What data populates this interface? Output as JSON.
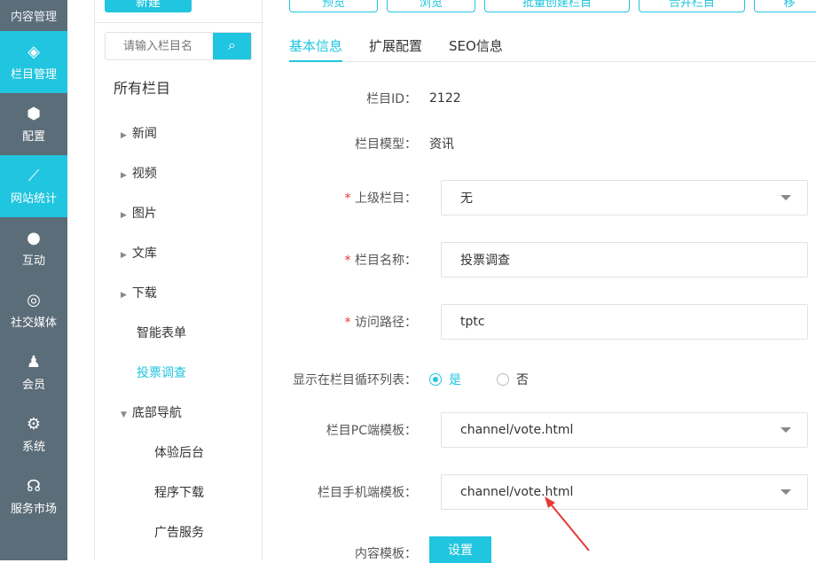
{
  "nav": [
    {
      "label": "内容管理",
      "icon": "document-icon"
    },
    {
      "label": "栏目管理",
      "icon": "layers-icon",
      "active": true
    },
    {
      "label": "配置",
      "icon": "cube-icon"
    },
    {
      "label": "网站统计",
      "icon": "chart-icon",
      "active": true
    },
    {
      "label": "互动",
      "icon": "chat-icon"
    },
    {
      "label": "社交媒体",
      "icon": "social-icon"
    },
    {
      "label": "会员",
      "icon": "user-icon"
    },
    {
      "label": "系统",
      "icon": "gear-icon"
    },
    {
      "label": "服务市场",
      "icon": "headset-icon"
    }
  ],
  "tree": {
    "new_label": "新建",
    "search_placeholder": "请输入栏目名",
    "all_label": "所有栏目",
    "items": [
      {
        "label": "新闻"
      },
      {
        "label": "视频"
      },
      {
        "label": "图片"
      },
      {
        "label": "文库"
      },
      {
        "label": "下载"
      },
      {
        "label": "智能表单"
      },
      {
        "label": "投票调查"
      },
      {
        "label": "底部导航"
      },
      {
        "label": "体验后台"
      },
      {
        "label": "程序下载"
      },
      {
        "label": "广告服务"
      }
    ]
  },
  "toolbar": [
    "预览",
    "浏览",
    "批量创建栏目",
    "合并栏目",
    "移"
  ],
  "tabs": [
    "基本信息",
    "扩展配置",
    "SEO信息"
  ],
  "form": {
    "id_label": "栏目ID：",
    "id_value": "2122",
    "model_label": "栏目模型：",
    "model_value": "资讯",
    "parent_label": "上级栏目：",
    "parent_value": "无",
    "name_label": "栏目名称：",
    "name_value": "投票调查",
    "path_label": "访问路径：",
    "path_value": "tptc",
    "show_label": "显示在栏目循环列表：",
    "yes": "是",
    "no": "否",
    "pc_label": "栏目PC端模板：",
    "pc_value": "channel/vote.html",
    "mobile_label": "栏目手机端模板：",
    "mobile_value": "channel/vote.html",
    "content_label": "内容模板：",
    "set_label": "设置",
    "required_mark": "*"
  }
}
